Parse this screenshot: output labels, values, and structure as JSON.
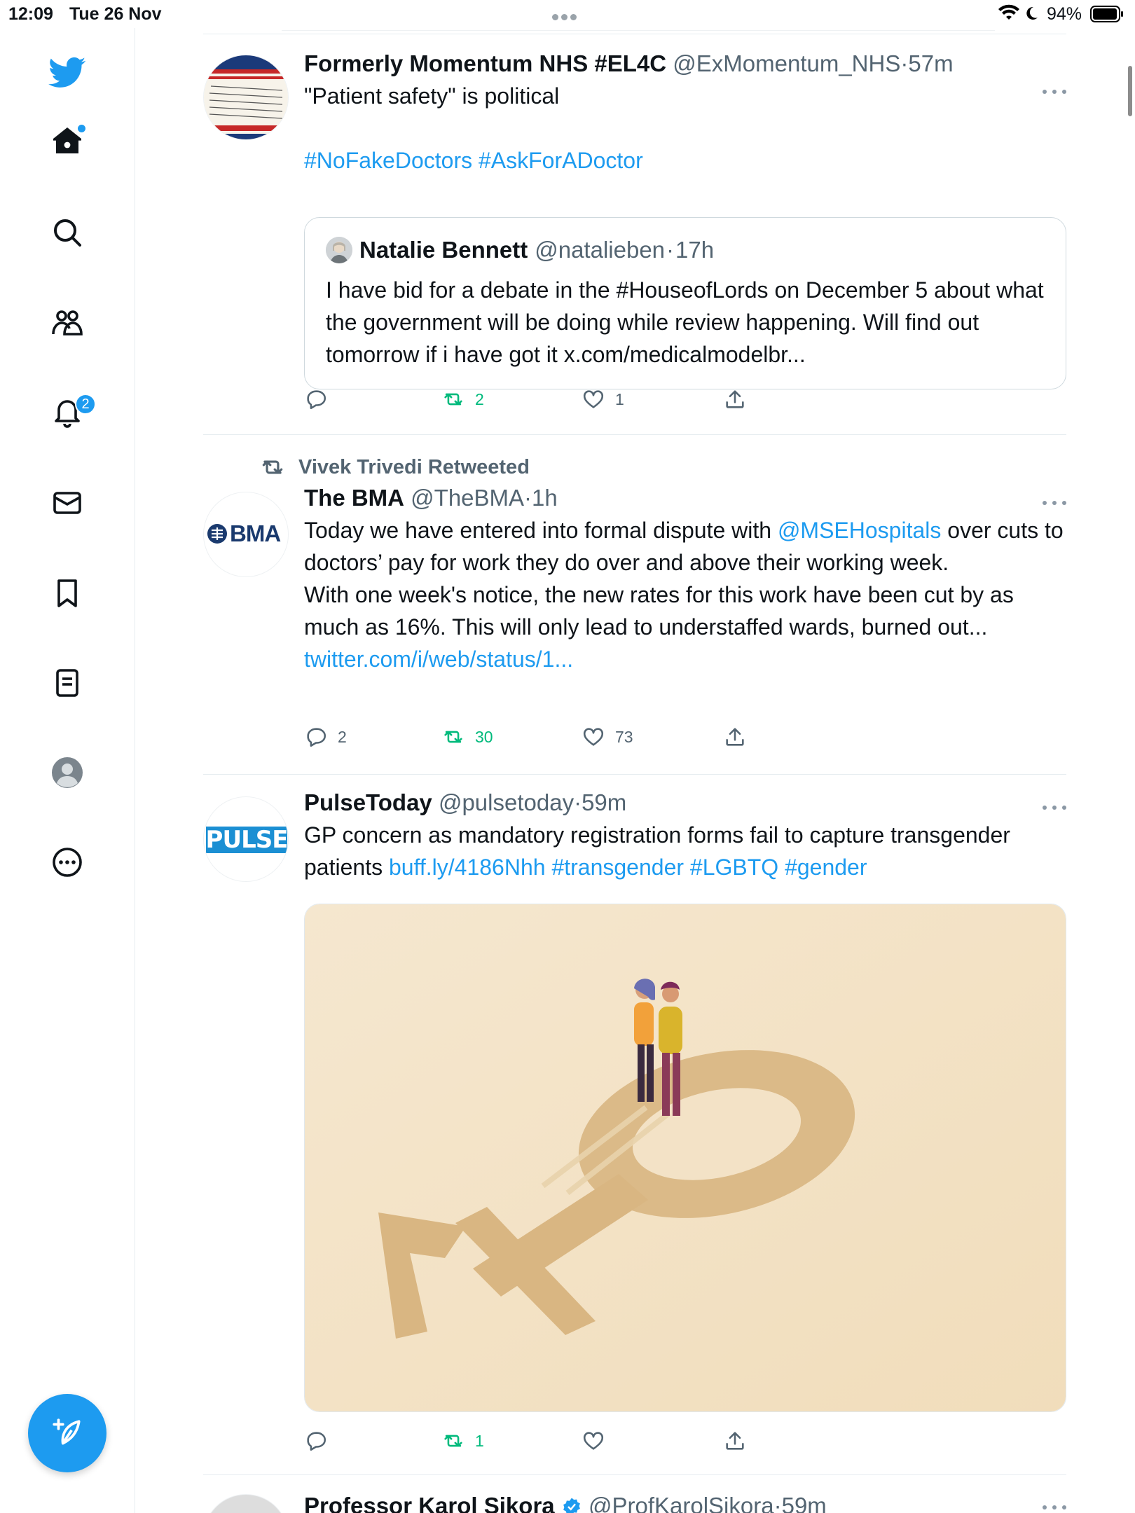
{
  "status_bar": {
    "time": "12:09",
    "date": "Tue 26 Nov",
    "battery": "94%"
  },
  "sidebar": {
    "items": [
      {
        "name": "home"
      },
      {
        "name": "explore"
      },
      {
        "name": "communities"
      },
      {
        "name": "notifications",
        "badge": "2"
      },
      {
        "name": "messages"
      },
      {
        "name": "bookmarks"
      },
      {
        "name": "lists"
      },
      {
        "name": "profile"
      },
      {
        "name": "more"
      }
    ],
    "accent": "#1d9bf0"
  },
  "tweets": [
    {
      "name": "Formerly Momentum NHS #EL4C",
      "handle": "@ExMomentum_NHS",
      "sep": "·",
      "time": "57m",
      "text": "\"Patient safety\" is political",
      "hashtags": "#NoFakeDoctors #AskForADoctor",
      "quote": {
        "name": "Natalie Bennett",
        "handle": "@natalieben",
        "sep": "·",
        "time": "17h",
        "text": "I have bid for a debate in the #HouseofLords on December 5 about what the government will be doing while review happening. Will find out tomorrow if i have got it x.com/medicalmodelbr..."
      },
      "actions": {
        "replies": "",
        "retweets": "2",
        "likes": "1"
      }
    },
    {
      "retweeted_by": "Vivek Trivedi Retweeted",
      "name": "The BMA",
      "handle": "@TheBMA",
      "sep": "·",
      "time": "1h",
      "avatar_text": "BMA",
      "text_part1": "Today we have entered into formal dispute with ",
      "mention": "@MSEHospitals",
      "text_part2": " over cuts to doctors’ pay for work they do over and above their working week.",
      "text_part3": "With one week's notice, the new rates for this work have been cut by as much as 16%. This will only lead to understaffed wards, burned out...",
      "link": "twitter.com/i/web/status/1...",
      "actions": {
        "replies": "2",
        "retweets": "30",
        "likes": "73"
      }
    },
    {
      "name": "PulseToday",
      "handle": "@pulsetoday",
      "sep": "·",
      "time": "59m",
      "avatar_text": "PULSE",
      "text_part1": "GP concern as mandatory registration forms fail to capture transgender patients ",
      "link": "buff.ly/4186Nhh",
      "hashtags": " #transgender #LGBTQ #gender",
      "actions": {
        "replies": "",
        "retweets": "1",
        "likes": ""
      }
    },
    {
      "name": "Professor Karol Sikora",
      "handle": "@ProfKarolSikora",
      "sep": "·",
      "time": "59m"
    }
  ],
  "colors": {
    "accent": "#1d9bf0",
    "retweet": "#00ba7c",
    "muted": "#536471"
  }
}
